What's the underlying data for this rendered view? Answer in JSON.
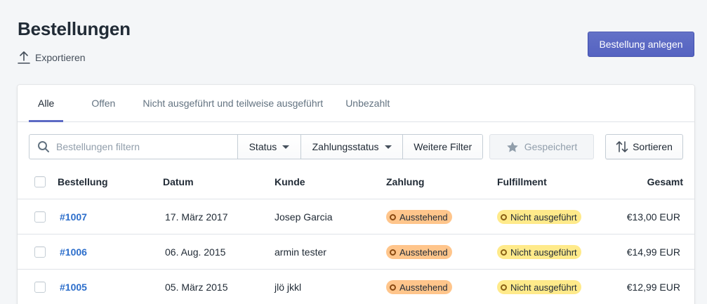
{
  "page": {
    "title": "Bestellungen",
    "export_label": "Exportieren",
    "create_button": "Bestellung anlegen"
  },
  "tabs": [
    {
      "label": "Alle",
      "active": true
    },
    {
      "label": "Offen",
      "active": false
    },
    {
      "label": "Nicht ausgeführt und teilweise ausgeführt",
      "active": false
    },
    {
      "label": "Unbezahlt",
      "active": false
    }
  ],
  "filters": {
    "search_placeholder": "Bestellungen filtern",
    "status_label": "Status",
    "payment_status_label": "Zahlungsstatus",
    "more_filters_label": "Weitere Filter",
    "saved_label": "Gespeichert",
    "sort_label": "Sortieren"
  },
  "table": {
    "columns": [
      "Bestellung",
      "Datum",
      "Kunde",
      "Zahlung",
      "Fulfillment",
      "Gesamt"
    ],
    "rows": [
      {
        "order": "#1007",
        "date": "17. März 2017",
        "customer": "Josep Garcia",
        "payment": "Ausstehend",
        "fulfillment": "Nicht ausgeführt",
        "total": "€13,00 EUR"
      },
      {
        "order": "#1006",
        "date": "06. Aug. 2015",
        "customer": "armin tester",
        "payment": "Ausstehend",
        "fulfillment": "Nicht ausgeführt",
        "total": "€14,99 EUR"
      },
      {
        "order": "#1005",
        "date": "05. März 2015",
        "customer": "jlö jkkl",
        "payment": "Ausstehend",
        "fulfillment": "Nicht ausgeführt",
        "total": "€12,99 EUR"
      }
    ]
  },
  "icons": {
    "export": "upload-icon",
    "search": "search-icon",
    "saved": "star-icon",
    "sort": "sort-icon"
  },
  "colors": {
    "accent": "#5c6ac4",
    "link": "#2c6ecb",
    "pending_badge": "#ffc58b",
    "unfulfilled_badge": "#ffea8a"
  }
}
